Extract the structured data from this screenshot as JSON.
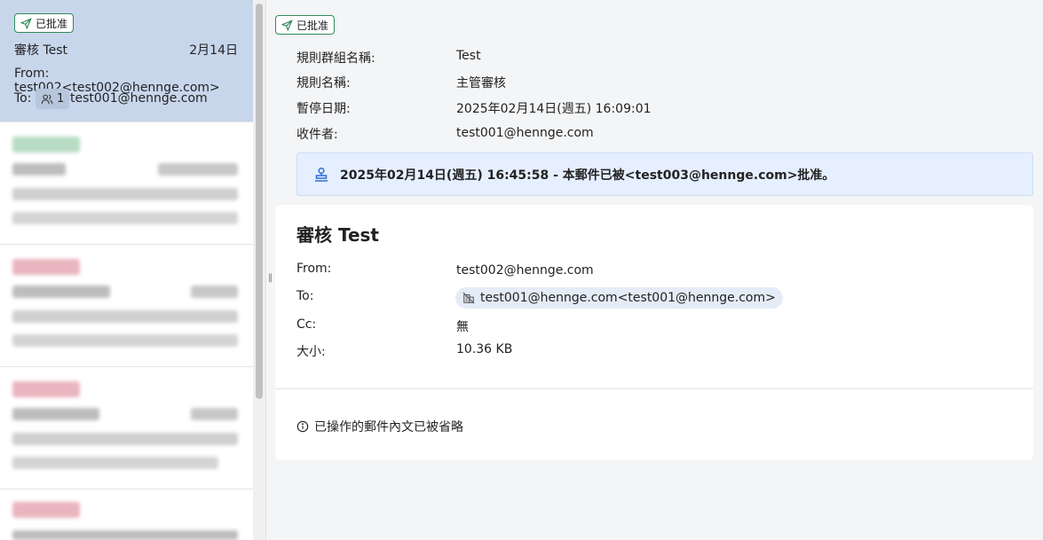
{
  "list": {
    "selected": {
      "badge": "已批准",
      "subject": "審核 Test",
      "date": "2月14日",
      "from": "From: test002<test002@hennge.com>",
      "to_label": "To:",
      "recipient_count": "1",
      "to_address": "test001@hennge.com"
    }
  },
  "detail": {
    "badge": "已批准",
    "meta": {
      "rule_group_label": "規則群組名稱:",
      "rule_group_value": "Test",
      "rule_name_label": "規則名稱:",
      "rule_name_value": "主管審核",
      "pause_date_label": "暫停日期:",
      "pause_date_value": "2025年02月14日(週五) 16:09:01",
      "recipient_label": "收件者:",
      "recipient_value": "test001@hennge.com"
    },
    "notice": "2025年02月14日(週五) 16:45:58 - 本郵件已被<test003@hennge.com>批准。",
    "mail": {
      "subject": "審核 Test",
      "from_label": "From:",
      "from_value": "test002@hennge.com",
      "to_label": "To:",
      "to_value": "test001@hennge.com<test001@hennge.com>",
      "cc_label": "Cc:",
      "cc_value": "無",
      "size_label": "大小:",
      "size_value": "10.36 KB",
      "omitted_note": "已操作的郵件內文已被省略"
    }
  },
  "colors": {
    "selected_bg": "#c8d6ec",
    "approved_green": "#2f8a5a",
    "notice_bg": "#e5efff",
    "notice_icon": "#2b6fd6"
  }
}
